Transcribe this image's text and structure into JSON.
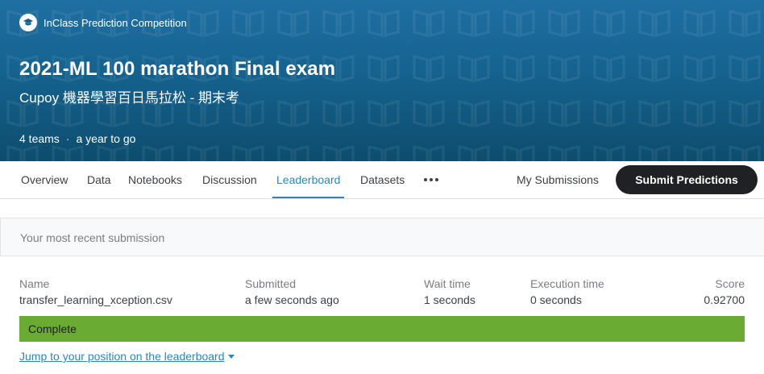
{
  "banner": {
    "competition_type": "InClass Prediction Competition",
    "title": "2021-ML 100 marathon Final exam",
    "subtitle": "Cupoy 機器學習百日馬拉松 - 期末考",
    "teams": "4 teams",
    "separator": "·",
    "time_left": "a year to go",
    "icon": "graduation-cap-icon"
  },
  "tabs": [
    {
      "label": "Overview"
    },
    {
      "label": "Data"
    },
    {
      "label": "Notebooks"
    },
    {
      "label": "Discussion"
    },
    {
      "label": "Leaderboard",
      "active": true
    },
    {
      "label": "Datasets"
    }
  ],
  "more_icon": "more-dots-icon",
  "my_submissions_label": "My Submissions",
  "submit_label": "Submit Predictions",
  "submission": {
    "header": "Your most recent submission",
    "columns": {
      "name": "Name",
      "submitted": "Submitted",
      "wait_time": "Wait time",
      "execution_time": "Execution time",
      "score": "Score"
    },
    "values": {
      "name": "transfer_learning_xception.csv",
      "submitted": "a few seconds ago",
      "wait_time": "1 seconds",
      "execution_time": "0 seconds",
      "score": "0.92700"
    },
    "status": "Complete",
    "status_color": "#69ab33",
    "jump_link": "Jump to your position on the leaderboard"
  },
  "colors": {
    "banner": "#15628f",
    "accent": "#2a86c7",
    "button": "#202124"
  }
}
